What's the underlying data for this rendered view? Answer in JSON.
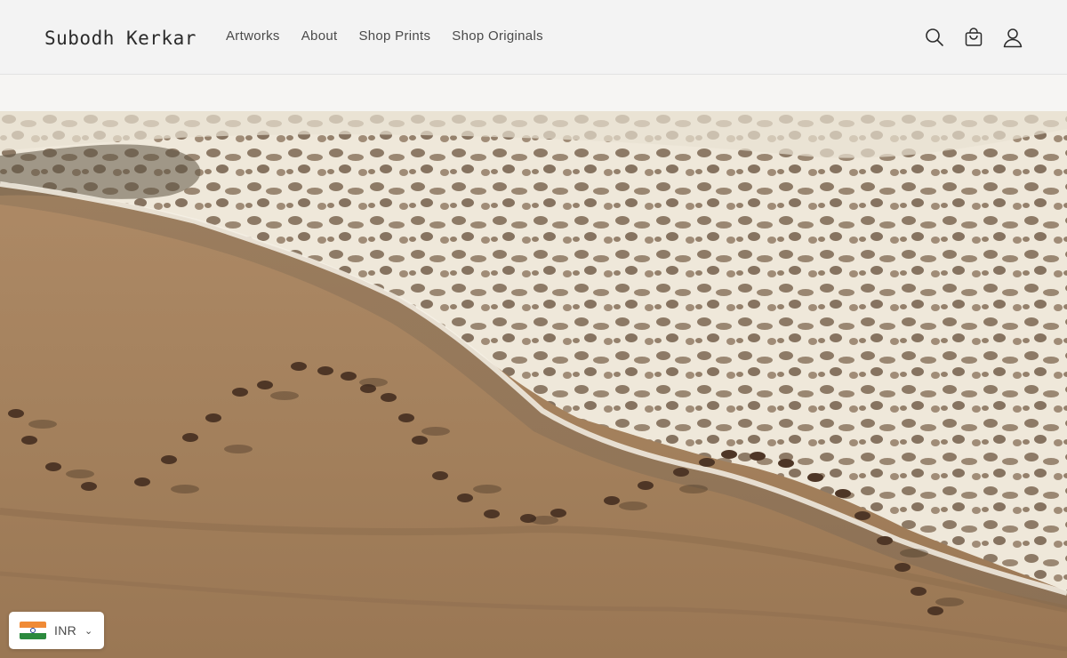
{
  "header": {
    "logo": "Subodh Kerkar",
    "nav": [
      {
        "label": "Artworks"
      },
      {
        "label": "About"
      },
      {
        "label": "Shop Prints"
      },
      {
        "label": "Shop Originals"
      }
    ],
    "icons": [
      "search-icon",
      "cart-icon",
      "account-icon"
    ]
  },
  "hero": {
    "image": "aerial-beach-procession-photo"
  },
  "currency_selector": {
    "code": "INR",
    "flag": "india-flag-icon",
    "chevron": "chevron-down-icon"
  },
  "colors": {
    "header_bg": "#f3f3f3",
    "text": "#2b2b2b",
    "sand": "#a98561",
    "surf": "#efe9dc"
  }
}
